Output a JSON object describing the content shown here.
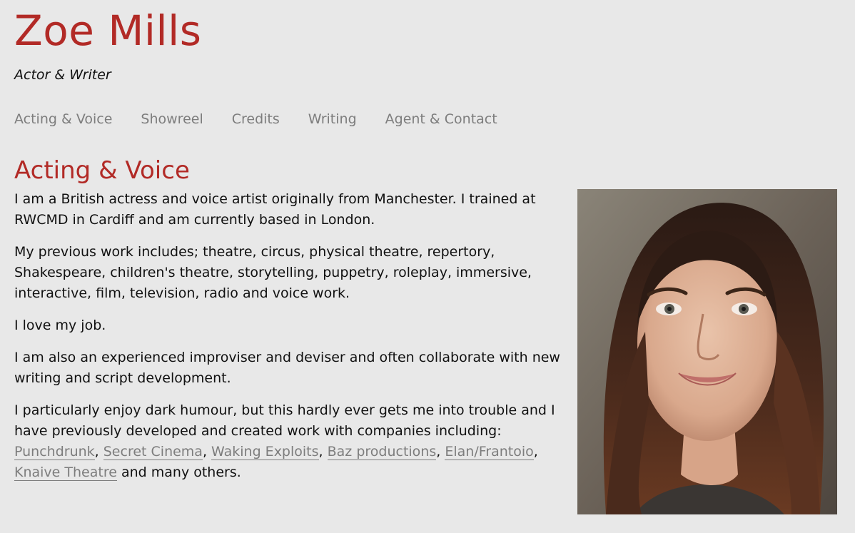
{
  "site": {
    "name": "Zoe Mills",
    "tagline": "Actor & Writer"
  },
  "nav": {
    "items": [
      {
        "label": "Acting & Voice"
      },
      {
        "label": "Showreel"
      },
      {
        "label": "Credits"
      },
      {
        "label": "Writing"
      },
      {
        "label": "Agent & Contact"
      }
    ]
  },
  "main": {
    "title": "Acting & Voice",
    "paragraphs": [
      "I am a British actress and voice artist originally from Manchester. I trained at RWCMD in Cardiff and am currently based in London.",
      "My previous work includes; theatre, circus, physical theatre, repertory, Shakespeare, children's theatre, storytelling, puppetry, roleplay, immersive, interactive, film, television, radio and voice work.",
      "I love my job.",
      "I am also an experienced improviser and deviser and often collaborate with new writing and script development."
    ],
    "last_paragraph": {
      "intro": "I particularly enjoy dark humour, but this hardly ever gets me into trouble and I have previously developed and created work with companies including: ",
      "companies": [
        "Punchdrunk",
        "Secret Cinema",
        "Waking Exploits",
        "Baz productions",
        "Elan/Frantoio",
        "Knaive Theatre"
      ],
      "separator": ", ",
      "outro": " and many others."
    }
  },
  "colors": {
    "background": "#e8e8e8",
    "accent": "#b22a26",
    "nav_link": "#7d7d7d",
    "text": "#111111"
  }
}
